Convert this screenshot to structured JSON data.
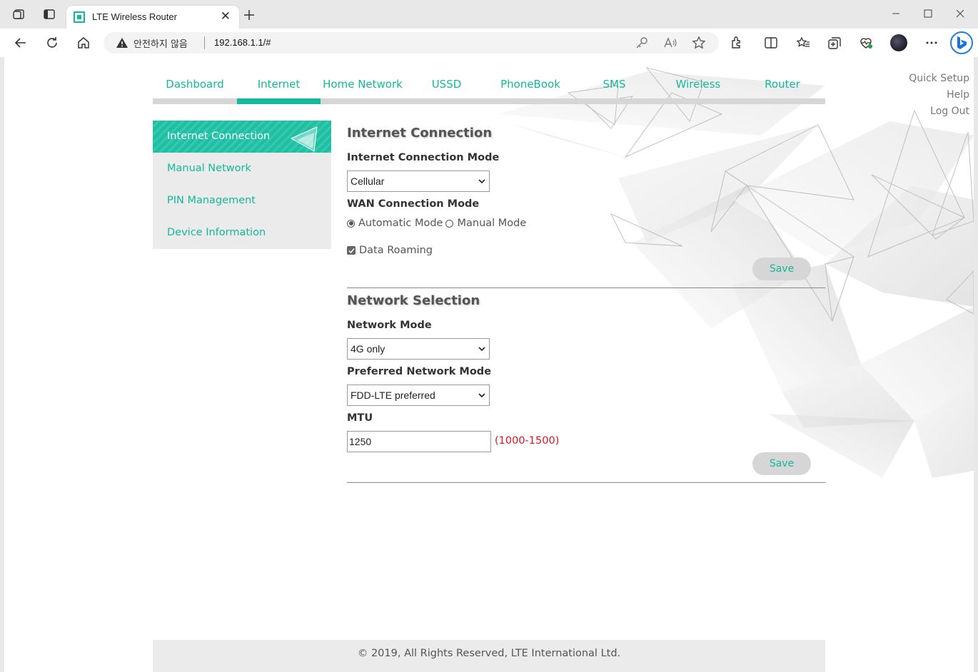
{
  "browser": {
    "tab_title": "LTE Wireless Router",
    "security_text": "안전하지 않음",
    "url": "192.168.1.1/#"
  },
  "nav": {
    "items": [
      "Dashboard",
      "Internet",
      "Home Network",
      "USSD",
      "PhoneBook",
      "SMS",
      "Wireless",
      "Router"
    ],
    "active": "Internet"
  },
  "quick_links": [
    "Quick Setup",
    "Help",
    "Log Out"
  ],
  "sidebar": {
    "items": [
      "Internet Connection",
      "Manual Network",
      "PIN Management",
      "Device Information"
    ],
    "active": "Internet Connection"
  },
  "internet_connection": {
    "title": "Internet Connection",
    "mode_label": "Internet Connection Mode",
    "mode_value": "Cellular",
    "wan_label": "WAN Connection Mode",
    "wan_options": [
      "Automatic Mode",
      "Manual Mode"
    ],
    "wan_selected": "Automatic Mode",
    "roaming_label": "Data Roaming",
    "roaming_checked": true,
    "save_label": "Save"
  },
  "network_selection": {
    "title": "Network Selection",
    "network_mode_label": "Network Mode",
    "network_mode_value": "4G only",
    "preferred_label": "Preferred Network Mode",
    "preferred_value": "FDD-LTE preferred",
    "mtu_label": "MTU",
    "mtu_value": "1250",
    "mtu_range": "(1000-1500)",
    "save_label": "Save"
  },
  "footer": {
    "text": "© 2019, All Rights Reserved, LTE International Ltd."
  },
  "colors": {
    "accent": "#16b99d",
    "error": "#e0141e"
  }
}
